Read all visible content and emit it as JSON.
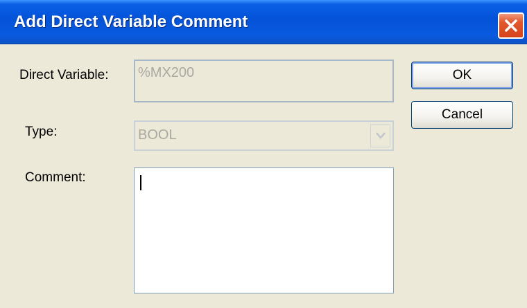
{
  "dialog": {
    "title": "Add Direct Variable Comment"
  },
  "fields": {
    "direct_variable_label": "Direct Variable:",
    "direct_variable_value": "%MX200",
    "type_label": "Type:",
    "type_value": "BOOL",
    "comment_label": "Comment:",
    "comment_value": ""
  },
  "buttons": {
    "ok_label": "OK",
    "cancel_label": "Cancel"
  },
  "icons": {
    "close": "close-icon",
    "dropdown": "chevron-down-icon"
  },
  "colors": {
    "titlebar": "#0453d8",
    "close_button": "#e2582e",
    "dialog_bg": "#ece9d8"
  }
}
